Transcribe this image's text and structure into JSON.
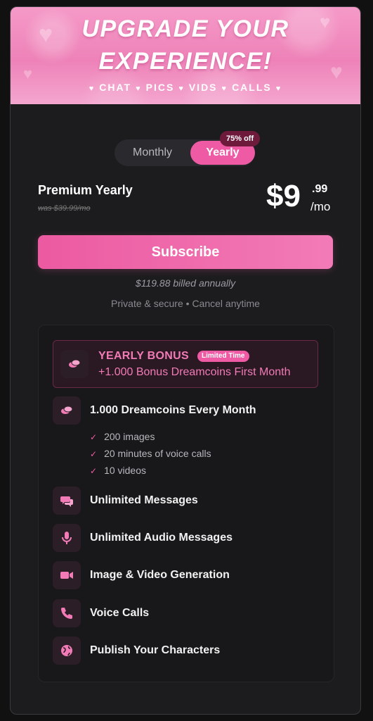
{
  "hero": {
    "line1": "UPGRADE YOUR",
    "line2": "EXPERIENCE!",
    "features": [
      "CHAT",
      "PICS",
      "VIDS",
      "CALLS"
    ]
  },
  "toggle": {
    "monthly": "Monthly",
    "yearly": "Yearly",
    "badge": "75% off",
    "selected": "Yearly"
  },
  "plan": {
    "name": "Premium Yearly",
    "was": "was $39.99/mo",
    "price_dollar": "$9",
    "price_cents": ".99",
    "price_period": "/mo"
  },
  "subscribe": {
    "label": "Subscribe",
    "billed": "$119.88 billed annually",
    "secure": "Private & secure • Cancel anytime"
  },
  "bonus": {
    "title": "YEARLY BONUS",
    "badge": "Limited Time",
    "description": "+1.000 Bonus Dreamcoins First Month"
  },
  "features": [
    {
      "label": "1.000 Dreamcoins Every Month",
      "icon": "coins-icon"
    },
    {
      "label": "Unlimited Messages",
      "icon": "chat-bubbles-icon"
    },
    {
      "label": "Unlimited Audio Messages",
      "icon": "microphone-icon"
    },
    {
      "label": "Image & Video Generation",
      "icon": "video-camera-icon"
    },
    {
      "label": "Voice Calls",
      "icon": "phone-icon"
    },
    {
      "label": "Publish Your Characters",
      "icon": "globe-icon"
    }
  ],
  "dreamcoin_includes": [
    "200 images",
    "20 minutes of voice calls",
    "10 videos"
  ],
  "colors": {
    "accent": "#ef5aa4",
    "accent_light": "#f27bb7",
    "card_bg": "#1c1c1e",
    "badge_bg": "#6e1b3b"
  }
}
